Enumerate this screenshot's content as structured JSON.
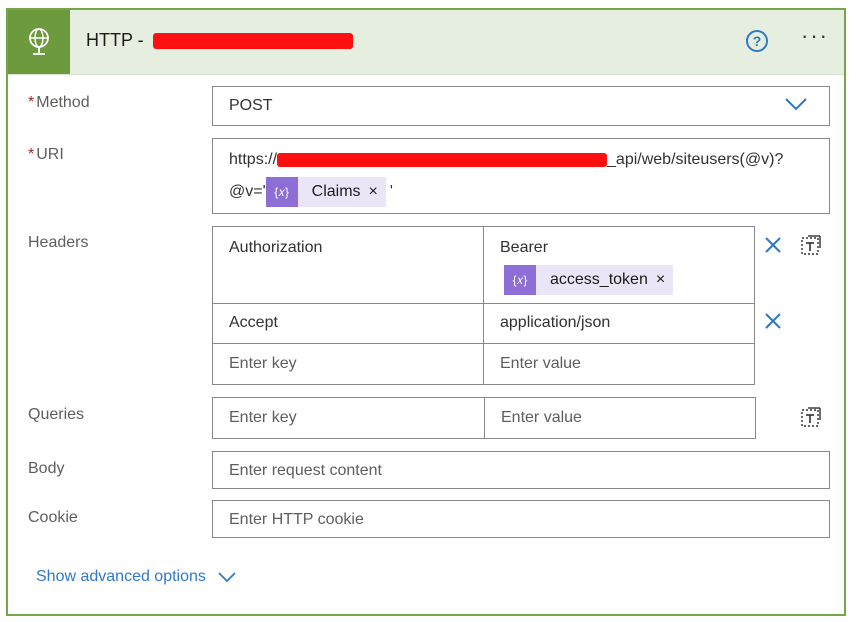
{
  "header": {
    "title_prefix": "HTTP -",
    "help_glyph": "?",
    "more_glyph": "···",
    "accent_color": "#6d9a3c"
  },
  "method": {
    "label": "Method",
    "required_mark": "*",
    "value": "POST"
  },
  "uri": {
    "label": "URI",
    "required_mark": "*",
    "line1_prefix": "https://",
    "line1_suffix": "_api/web/siteusers(@v)?",
    "line2_prefix": "@v='",
    "token_label": "Claims",
    "token_close": "×",
    "line2_suffix": "'"
  },
  "headers": {
    "label": "Headers",
    "rows": [
      {
        "key": "Authorization",
        "value": "Bearer",
        "token_label": "access_token",
        "token_close": "×"
      },
      {
        "key": "Accept",
        "value": "application/json"
      }
    ],
    "key_placeholder": "Enter key",
    "value_placeholder": "Enter value"
  },
  "queries": {
    "label": "Queries",
    "key_placeholder": "Enter key",
    "value_placeholder": "Enter value"
  },
  "body": {
    "label": "Body",
    "placeholder": "Enter request content"
  },
  "cookie": {
    "label": "Cookie",
    "placeholder": "Enter HTTP cookie"
  },
  "advanced": {
    "label": "Show advanced options"
  },
  "icons": {
    "connector": "globe-icon",
    "help": "question-circle-icon",
    "more": "ellipsis-icon",
    "dropdown": "chevron-down-icon",
    "token": "expression-icon",
    "delete_row": "x-icon",
    "switch_mode": "text-mode-icon"
  },
  "colors": {
    "link": "#2f79c8",
    "token_bg": "#ebe6f7",
    "token_icon": "#8c6ed6",
    "redaction": "#ff1010"
  }
}
